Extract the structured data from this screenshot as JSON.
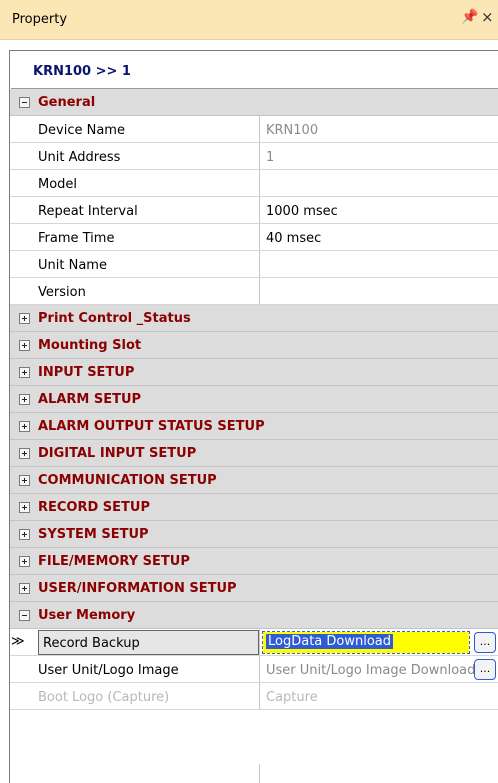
{
  "panel": {
    "title": "Property",
    "pin_glyph": "1",
    "close_glyph": "×"
  },
  "object_selector": "KRN100 >> 1",
  "general": {
    "label": "General",
    "expanded": true,
    "properties": [
      {
        "name": "Device Name",
        "value": "KRN100",
        "readonly": true
      },
      {
        "name": "Unit Address",
        "value": "1",
        "readonly": true
      },
      {
        "name": "Model",
        "value": ""
      },
      {
        "name": "Repeat Interval",
        "value": "1000 msec"
      },
      {
        "name": "Frame Time",
        "value": "40 msec"
      },
      {
        "name": "Unit Name",
        "value": ""
      },
      {
        "name": "Version",
        "value": ""
      }
    ]
  },
  "collapsed_categories": [
    "Print Control _Status",
    "Mounting Slot",
    "INPUT SETUP",
    "ALARM SETUP",
    "ALARM OUTPUT STATUS SETUP",
    "DIGITAL INPUT SETUP",
    "COMMUNICATION SETUP",
    "RECORD SETUP",
    "SYSTEM SETUP",
    "FILE/MEMORY SETUP",
    "USER/INFORMATION SETUP"
  ],
  "user_memory": {
    "label": "User Memory",
    "expanded": true,
    "record_backup": {
      "name": "Record Backup",
      "value": "LogData Download",
      "button": "..."
    },
    "user_unit_logo": {
      "name": "User Unit/Logo Image",
      "value": "User Unit/Logo Image Download",
      "button": "..."
    },
    "boot_logo": {
      "name": "Boot Logo (Capture)",
      "value": "Capture"
    }
  },
  "row_marker": "≫",
  "colors": {
    "title_bar": "#fbe6b5",
    "category_text": "#8b0000",
    "object_title": "#0a1470",
    "highlight": "#ffff00",
    "selection": "#2f5bd3"
  }
}
